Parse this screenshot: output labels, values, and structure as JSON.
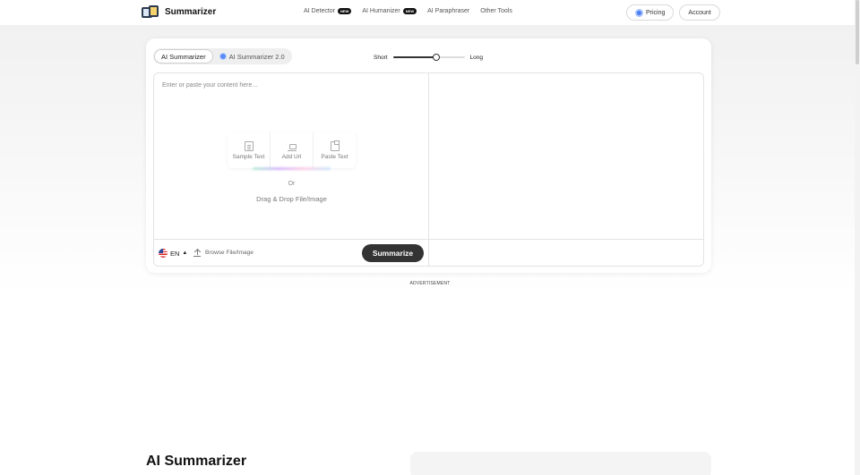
{
  "nav": {
    "brand": "Summarizer",
    "links": [
      {
        "label": "AI Detector",
        "badge": "NEW"
      },
      {
        "label": "AI Humanizer",
        "badge": "NEW"
      },
      {
        "label": "AI Paraphraser"
      },
      {
        "label": "Other Tools"
      }
    ],
    "pricing_label": "Pricing",
    "account_label": "Account"
  },
  "tool": {
    "tabs": [
      {
        "label": "AI Summarizer",
        "active": true
      },
      {
        "label": "AI Summarizer 2.0",
        "active": false
      }
    ],
    "length": {
      "short_label": "Short",
      "long_label": "Long",
      "value": 0.6
    },
    "placeholder": "Enter or paste your content here...",
    "quick_actions": [
      "Sample Text",
      "Add Url",
      "Paste Text"
    ],
    "or_label": "Or",
    "drag_drop_label": "Drag & Drop File/Image",
    "language": "EN",
    "browse_label": "Browse File/Image",
    "summarize_label": "Summarize"
  },
  "advertisement_label": "ADVERTISEMENT",
  "section": {
    "title": "AI Summarizer"
  },
  "colors": {
    "accent": "#333333",
    "pricing_icon": "#4a7df3"
  }
}
